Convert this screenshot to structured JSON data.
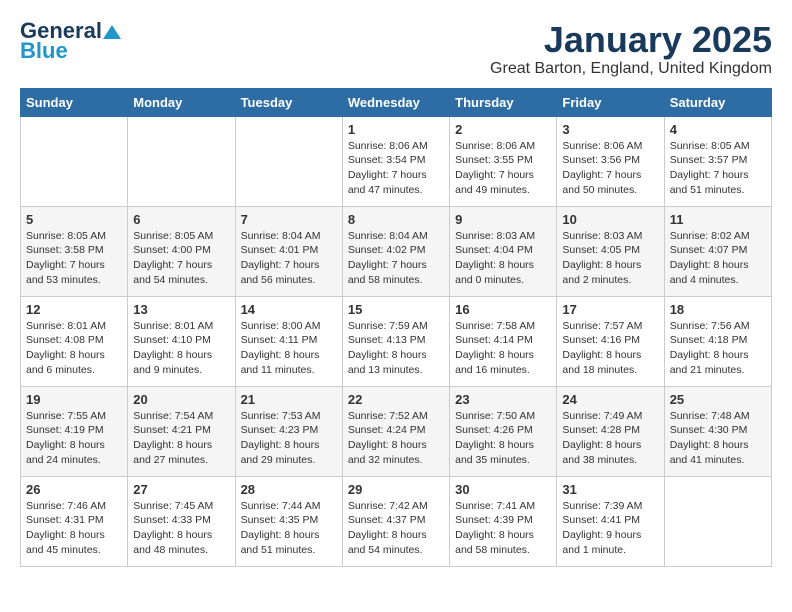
{
  "logo": {
    "text_general": "General",
    "text_blue": "Blue"
  },
  "calendar": {
    "title": "January 2025",
    "subtitle": "Great Barton, England, United Kingdom"
  },
  "headers": [
    "Sunday",
    "Monday",
    "Tuesday",
    "Wednesday",
    "Thursday",
    "Friday",
    "Saturday"
  ],
  "weeks": [
    [
      {
        "day": "",
        "info": ""
      },
      {
        "day": "",
        "info": ""
      },
      {
        "day": "",
        "info": ""
      },
      {
        "day": "1",
        "info": "Sunrise: 8:06 AM\nSunset: 3:54 PM\nDaylight: 7 hours\nand 47 minutes."
      },
      {
        "day": "2",
        "info": "Sunrise: 8:06 AM\nSunset: 3:55 PM\nDaylight: 7 hours\nand 49 minutes."
      },
      {
        "day": "3",
        "info": "Sunrise: 8:06 AM\nSunset: 3:56 PM\nDaylight: 7 hours\nand 50 minutes."
      },
      {
        "day": "4",
        "info": "Sunrise: 8:05 AM\nSunset: 3:57 PM\nDaylight: 7 hours\nand 51 minutes."
      }
    ],
    [
      {
        "day": "5",
        "info": "Sunrise: 8:05 AM\nSunset: 3:58 PM\nDaylight: 7 hours\nand 53 minutes."
      },
      {
        "day": "6",
        "info": "Sunrise: 8:05 AM\nSunset: 4:00 PM\nDaylight: 7 hours\nand 54 minutes."
      },
      {
        "day": "7",
        "info": "Sunrise: 8:04 AM\nSunset: 4:01 PM\nDaylight: 7 hours\nand 56 minutes."
      },
      {
        "day": "8",
        "info": "Sunrise: 8:04 AM\nSunset: 4:02 PM\nDaylight: 7 hours\nand 58 minutes."
      },
      {
        "day": "9",
        "info": "Sunrise: 8:03 AM\nSunset: 4:04 PM\nDaylight: 8 hours\nand 0 minutes."
      },
      {
        "day": "10",
        "info": "Sunrise: 8:03 AM\nSunset: 4:05 PM\nDaylight: 8 hours\nand 2 minutes."
      },
      {
        "day": "11",
        "info": "Sunrise: 8:02 AM\nSunset: 4:07 PM\nDaylight: 8 hours\nand 4 minutes."
      }
    ],
    [
      {
        "day": "12",
        "info": "Sunrise: 8:01 AM\nSunset: 4:08 PM\nDaylight: 8 hours\nand 6 minutes."
      },
      {
        "day": "13",
        "info": "Sunrise: 8:01 AM\nSunset: 4:10 PM\nDaylight: 8 hours\nand 9 minutes."
      },
      {
        "day": "14",
        "info": "Sunrise: 8:00 AM\nSunset: 4:11 PM\nDaylight: 8 hours\nand 11 minutes."
      },
      {
        "day": "15",
        "info": "Sunrise: 7:59 AM\nSunset: 4:13 PM\nDaylight: 8 hours\nand 13 minutes."
      },
      {
        "day": "16",
        "info": "Sunrise: 7:58 AM\nSunset: 4:14 PM\nDaylight: 8 hours\nand 16 minutes."
      },
      {
        "day": "17",
        "info": "Sunrise: 7:57 AM\nSunset: 4:16 PM\nDaylight: 8 hours\nand 18 minutes."
      },
      {
        "day": "18",
        "info": "Sunrise: 7:56 AM\nSunset: 4:18 PM\nDaylight: 8 hours\nand 21 minutes."
      }
    ],
    [
      {
        "day": "19",
        "info": "Sunrise: 7:55 AM\nSunset: 4:19 PM\nDaylight: 8 hours\nand 24 minutes."
      },
      {
        "day": "20",
        "info": "Sunrise: 7:54 AM\nSunset: 4:21 PM\nDaylight: 8 hours\nand 27 minutes."
      },
      {
        "day": "21",
        "info": "Sunrise: 7:53 AM\nSunset: 4:23 PM\nDaylight: 8 hours\nand 29 minutes."
      },
      {
        "day": "22",
        "info": "Sunrise: 7:52 AM\nSunset: 4:24 PM\nDaylight: 8 hours\nand 32 minutes."
      },
      {
        "day": "23",
        "info": "Sunrise: 7:50 AM\nSunset: 4:26 PM\nDaylight: 8 hours\nand 35 minutes."
      },
      {
        "day": "24",
        "info": "Sunrise: 7:49 AM\nSunset: 4:28 PM\nDaylight: 8 hours\nand 38 minutes."
      },
      {
        "day": "25",
        "info": "Sunrise: 7:48 AM\nSunset: 4:30 PM\nDaylight: 8 hours\nand 41 minutes."
      }
    ],
    [
      {
        "day": "26",
        "info": "Sunrise: 7:46 AM\nSunset: 4:31 PM\nDaylight: 8 hours\nand 45 minutes."
      },
      {
        "day": "27",
        "info": "Sunrise: 7:45 AM\nSunset: 4:33 PM\nDaylight: 8 hours\nand 48 minutes."
      },
      {
        "day": "28",
        "info": "Sunrise: 7:44 AM\nSunset: 4:35 PM\nDaylight: 8 hours\nand 51 minutes."
      },
      {
        "day": "29",
        "info": "Sunrise: 7:42 AM\nSunset: 4:37 PM\nDaylight: 8 hours\nand 54 minutes."
      },
      {
        "day": "30",
        "info": "Sunrise: 7:41 AM\nSunset: 4:39 PM\nDaylight: 8 hours\nand 58 minutes."
      },
      {
        "day": "31",
        "info": "Sunrise: 7:39 AM\nSunset: 4:41 PM\nDaylight: 9 hours\nand 1 minute."
      },
      {
        "day": "",
        "info": ""
      }
    ]
  ]
}
